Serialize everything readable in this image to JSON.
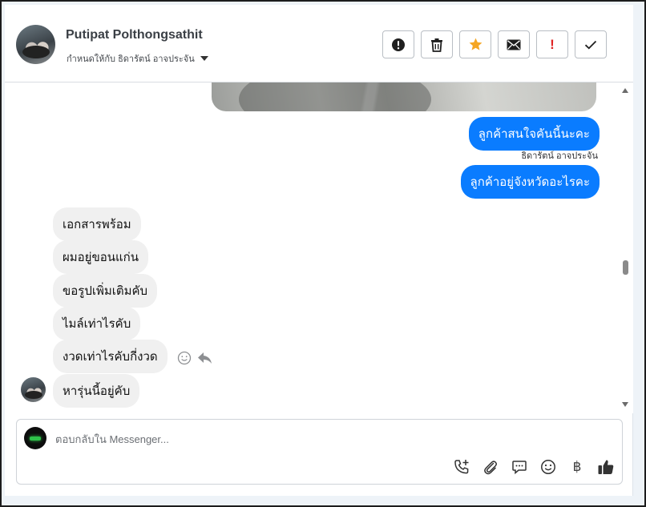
{
  "contact": {
    "name": "Putipat Polthongsathit",
    "assigned_to": "กำหนดให้กับ ธิดารัตน์ อาจประจัน"
  },
  "toolbar": {
    "buttons": [
      {
        "name": "report-button",
        "icon": "alert-circle-icon"
      },
      {
        "name": "delete-button",
        "icon": "trash-icon"
      },
      {
        "name": "star-button",
        "icon": "star-icon",
        "color": "#f5a623"
      },
      {
        "name": "mark-unread-button",
        "icon": "envelope-icon"
      },
      {
        "name": "follow-up-button",
        "icon": "exclamation-icon",
        "text": "!",
        "color": "#e02424"
      },
      {
        "name": "mark-done-button",
        "icon": "check-icon"
      }
    ]
  },
  "messages": {
    "outgoing": [
      {
        "text": "ลูกค้าสนใจคันนี้นะคะ"
      },
      {
        "text": "ลูกค้าอยู่จังหวัดอะไรคะ"
      }
    ],
    "sender_label": "ธิดารัตน์ อาจประจัน",
    "incoming": [
      {
        "text": "เอกสารพร้อม"
      },
      {
        "text": "ผมอยู่ขอนแก่น"
      },
      {
        "text": "ขอรูปเพิ่มเติมคับ"
      },
      {
        "text": "ไมล์เท่าไรคับ"
      },
      {
        "text": "งวดเท่าไรคับกี่งวด"
      },
      {
        "text": "หารุ่นนี้อยู่คับ"
      }
    ]
  },
  "composer": {
    "placeholder": "ตอบกลับใน Messenger...",
    "tools": [
      "call-plus-icon",
      "paperclip-icon",
      "saved-reply-icon",
      "emoji-icon",
      "baht-icon",
      "thumbs-up-icon"
    ],
    "baht_symbol": "฿"
  },
  "colors": {
    "outgoing_bubble": "#0a7cff",
    "incoming_bubble": "#f0f0f0",
    "star": "#f5a623",
    "alert": "#e02424"
  }
}
